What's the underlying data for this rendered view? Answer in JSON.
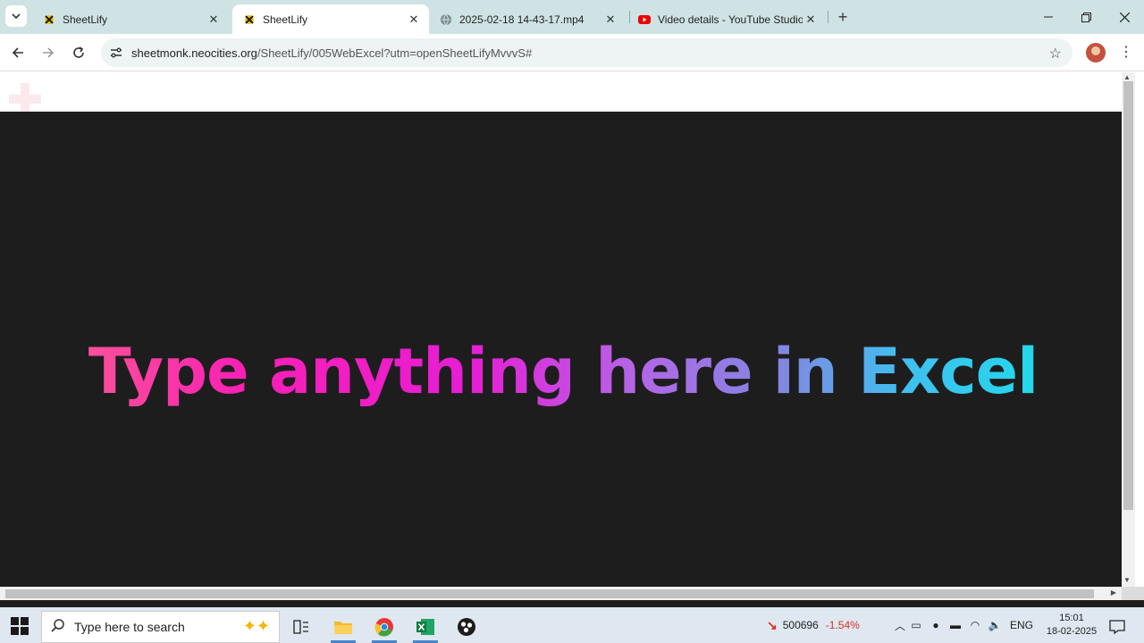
{
  "browser": {
    "tabs": [
      {
        "title": "SheetLify",
        "icon": "sheetlify-icon",
        "active": false
      },
      {
        "title": "SheetLify",
        "icon": "sheetlify-icon",
        "active": true
      },
      {
        "title": "2025-02-18 14-43-17.mp4",
        "icon": "globe-icon",
        "active": false
      },
      {
        "title": "Video details - YouTube Studio",
        "icon": "youtube-icon",
        "active": false
      }
    ],
    "url_host": "sheetmonk.neocities.org",
    "url_path": "/SheetLify/005WebExcel?utm=openSheetLifyMvvvS#"
  },
  "page": {
    "headline": "Type anything here in Excel",
    "gradient_colors": [
      "#fb6b8a",
      "#f91fb5",
      "#e61ed6",
      "#b564e6",
      "#7f8ae2",
      "#40bff0",
      "#10e8e6"
    ],
    "background": "#1e1d1e"
  },
  "taskbar": {
    "search_placeholder": "Type here to search",
    "stock_value": "500696",
    "stock_change": "-1.54%",
    "language": "ENG",
    "time": "15:01",
    "date": "18-02-2025"
  }
}
